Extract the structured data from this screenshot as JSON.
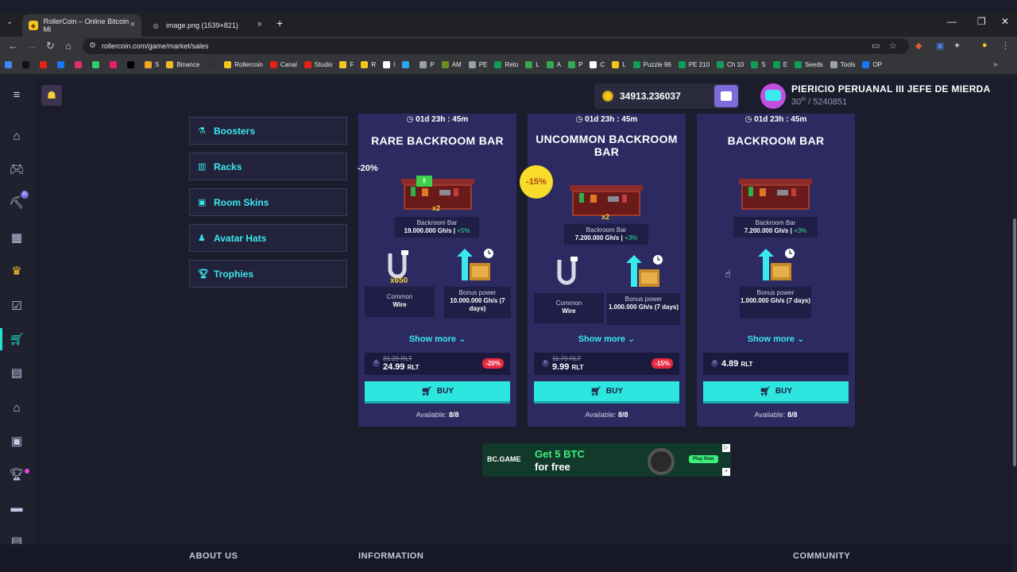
{
  "browser": {
    "tabs": [
      {
        "title": "RollerCoin – Online Bitcoin Mi",
        "active": true
      },
      {
        "title": "image.png (1539×821)",
        "active": false
      }
    ],
    "url": "rollercoin.com/game/market/sales",
    "bookmarks": [
      {
        "label": "",
        "color": "#4285f4"
      },
      {
        "label": "",
        "color": "#111111"
      },
      {
        "label": "",
        "color": "#e62117"
      },
      {
        "label": "",
        "color": "#1877f2"
      },
      {
        "label": "",
        "color": "#e1306c"
      },
      {
        "label": "",
        "color": "#2ecc71"
      },
      {
        "label": "",
        "color": "#e91e63"
      },
      {
        "label": "",
        "color": "#000000"
      },
      {
        "label": "S",
        "color": "#f4a623"
      },
      {
        "label": "Binance",
        "color": "#f3ba2f"
      },
      {
        "label": "",
        "color": "#333333"
      },
      {
        "label": "Rollercoin",
        "color": "#f5c622"
      },
      {
        "label": "Canal",
        "color": "#e62117"
      },
      {
        "label": "Studio",
        "color": "#e62117"
      },
      {
        "label": "F",
        "color": "#f5c622"
      },
      {
        "label": "R",
        "color": "#f5c622"
      },
      {
        "label": "I",
        "color": "#ffffff"
      },
      {
        "label": "",
        "color": "#29a9eb"
      },
      {
        "label": "P",
        "color": "#9aa0a6"
      },
      {
        "label": "AM",
        "color": "#6b8e23"
      },
      {
        "label": "PE",
        "color": "#9aa0a6"
      },
      {
        "label": "Reto",
        "color": "#0f9d58"
      },
      {
        "label": "L",
        "color": "#34a853"
      },
      {
        "label": "A",
        "color": "#34a853"
      },
      {
        "label": "P",
        "color": "#34a853"
      },
      {
        "label": "C",
        "color": "#ffffff"
      },
      {
        "label": "L",
        "color": "#f5c622"
      },
      {
        "label": "Puzzle 96",
        "color": "#0f9d58"
      },
      {
        "label": "PE 210",
        "color": "#0f9d58"
      },
      {
        "label": "Ch 10",
        "color": "#0f9d58"
      },
      {
        "label": "S",
        "color": "#0f9d58"
      },
      {
        "label": "E",
        "color": "#0f9d58"
      },
      {
        "label": "Seeds",
        "color": "#0f9d58"
      },
      {
        "label": "Tools",
        "color": "#9aa0a6"
      },
      {
        "label": "OP",
        "color": "#1877f2"
      }
    ]
  },
  "header": {
    "balance": "34913.236037",
    "username": "PIERICIO PERUANAL III JEFE DE MIERDA",
    "rank": "30",
    "rank_suffix": "th",
    "total": "/ 5240851"
  },
  "left_nav": {
    "items": [
      "home-icon",
      "gamepad-icon",
      "mining-icon",
      "calendar-icon",
      "crown-icon",
      "tasks-icon",
      "market-icon",
      "shop-icon",
      "bank-icon",
      "gift-icon",
      "trophy-icon",
      "layers-icon",
      "table-icon"
    ],
    "active": "market-icon"
  },
  "menu": [
    {
      "label": "Boosters",
      "icon": "flask-icon"
    },
    {
      "label": "Racks",
      "icon": "rack-icon"
    },
    {
      "label": "Room Skins",
      "icon": "room-icon"
    },
    {
      "label": "Avatar Hats",
      "icon": "hat-icon"
    },
    {
      "label": "Trophies",
      "icon": "trophy-icon"
    }
  ],
  "cards": [
    {
      "timer": "01d 23h : 45m",
      "title": "RARE BACKROOM BAR",
      "discount_side": "-20%",
      "multiplier": "x2",
      "product_name": "Backroom Bar",
      "product_power": "19.000.000 Gh/s |",
      "product_pct": "+5%",
      "item1_badge": "x650",
      "item1_l1": "Common",
      "item1_l2": "Wire",
      "item2_l1": "Bonus power",
      "item2_l2": "10.000.000 Gh/s (7 days)",
      "show_more": "Show more",
      "old_price": "31.29 RLT",
      "price": "24.99",
      "currency": "RLT",
      "badge": "-20%",
      "buy": "BUY",
      "available_label": "Available:",
      "available": "8/8"
    },
    {
      "timer": "01d 23h : 45m",
      "title": "UNCOMMON BACKROOM BAR",
      "discount_side": "-15%",
      "multiplier": "x2",
      "product_name": "Backroom Bar",
      "product_power": "7.200.000 Gh/s |",
      "product_pct": "+3%",
      "item1_l1": "Common",
      "item1_l2": "Wire",
      "item2_l1": "Bonus power",
      "item2_l2": "1.000.000 Gh/s (7 days)",
      "show_more": "Show more",
      "old_price": "11.79 RLT",
      "price": "9.99",
      "currency": "RLT",
      "badge": "-15%",
      "buy": "BUY",
      "available_label": "Available:",
      "available": "8/8"
    },
    {
      "timer": "01d 23h : 45m",
      "title": "BACKROOM BAR",
      "product_name": "Backroom Bar",
      "product_power": "7.200.000 Gh/s |",
      "product_pct": "+3%",
      "item2_l1": "Bonus power",
      "item2_l2": "1.000.000 Gh/s (7 days)",
      "show_more": "Show more",
      "price": "4.89",
      "currency": "RLT",
      "buy": "BUY",
      "available_label": "Available:",
      "available": "8/8"
    }
  ],
  "ad": {
    "brand": "BC.GAME",
    "line1": "Get 5 BTC",
    "line2": "for free",
    "cta": "Play Now"
  },
  "footer": {
    "col1": "ABOUT US",
    "col2": "INFORMATION",
    "col3": "COMMUNITY"
  },
  "colors": {
    "accent": "#3ae8ef",
    "card_bg": "#2c2a60",
    "buy_button": "#2ee6e0",
    "discount_red": "#e8293f",
    "coin_gold": "#f5c622"
  }
}
